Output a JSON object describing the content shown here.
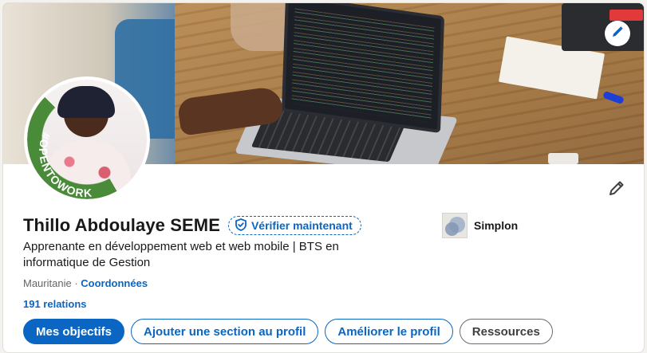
{
  "profile": {
    "name": "Thillo Abdoulaye SEME",
    "verify_label": "Vérifier maintenant",
    "headline": "Apprenante en développement web et web mobile | BTS en informatique de Gestion",
    "location": "Mauritanie",
    "separator": " · ",
    "contact_link": "Coordonnées",
    "relations": "191 relations",
    "open_to_work": "#OPENTOWORK"
  },
  "company": {
    "name": "Simplon"
  },
  "actions": {
    "primary": "Mes objectifs",
    "add_section": "Ajouter une section au profil",
    "improve": "Améliorer le profil",
    "resources": "Ressources"
  },
  "icons": {
    "banner_edit": "pencil-icon",
    "profile_edit": "pencil-icon",
    "verify": "shield-check-icon"
  },
  "colors": {
    "accent": "#0a66c2",
    "open_to_work": "#4a8b3a",
    "text": "#191919",
    "muted": "#666666"
  }
}
